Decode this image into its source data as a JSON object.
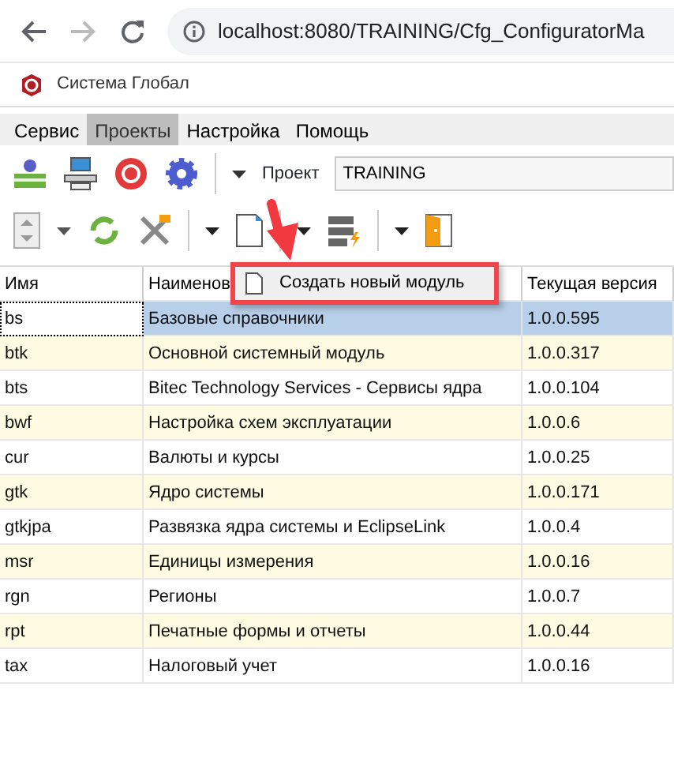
{
  "browser": {
    "url": "localhost:8080/TRAINING/Cfg_ConfiguratorMa"
  },
  "app": {
    "title": "Система Глобал"
  },
  "menu": [
    {
      "label": "Сервис",
      "selected": false
    },
    {
      "label": "Проекты",
      "selected": true
    },
    {
      "label": "Настройка",
      "selected": false
    },
    {
      "label": "Помощь",
      "selected": false
    }
  ],
  "project": {
    "label": "Проект",
    "value": "TRAINING"
  },
  "popup_menu": {
    "items": [
      {
        "label": "Создать новый модуль"
      }
    ]
  },
  "table": {
    "columns": [
      "Имя",
      "Наименов",
      "Текущая версия"
    ],
    "rows": [
      {
        "cells": [
          "bs",
          "Базовые справочники",
          "1.0.0.595"
        ],
        "selected": true
      },
      {
        "cells": [
          "btk",
          "Основной системный модуль",
          "1.0.0.317"
        ],
        "selected": false
      },
      {
        "cells": [
          "bts",
          "Bitec Technology Services - Сервисы ядра",
          "1.0.0.104"
        ],
        "selected": false
      },
      {
        "cells": [
          "bwf",
          "Настройка схем эксплуатации",
          "1.0.0.6"
        ],
        "selected": false
      },
      {
        "cells": [
          "cur",
          "Валюты и курсы",
          "1.0.0.25"
        ],
        "selected": false
      },
      {
        "cells": [
          "gtk",
          "Ядро системы",
          "1.0.0.171"
        ],
        "selected": false
      },
      {
        "cells": [
          "gtkjpa",
          "Развязка ядра системы и EclipseLink",
          "1.0.0.4"
        ],
        "selected": false
      },
      {
        "cells": [
          "msr",
          "Единицы измерения",
          "1.0.0.16"
        ],
        "selected": false
      },
      {
        "cells": [
          "rgn",
          "Регионы",
          "1.0.0.7"
        ],
        "selected": false
      },
      {
        "cells": [
          "rpt",
          "Печатные формы и отчеты",
          "1.0.0.44"
        ],
        "selected": false
      },
      {
        "cells": [
          "tax",
          "Налоговый учет",
          "1.0.0.16"
        ],
        "selected": false
      }
    ]
  }
}
